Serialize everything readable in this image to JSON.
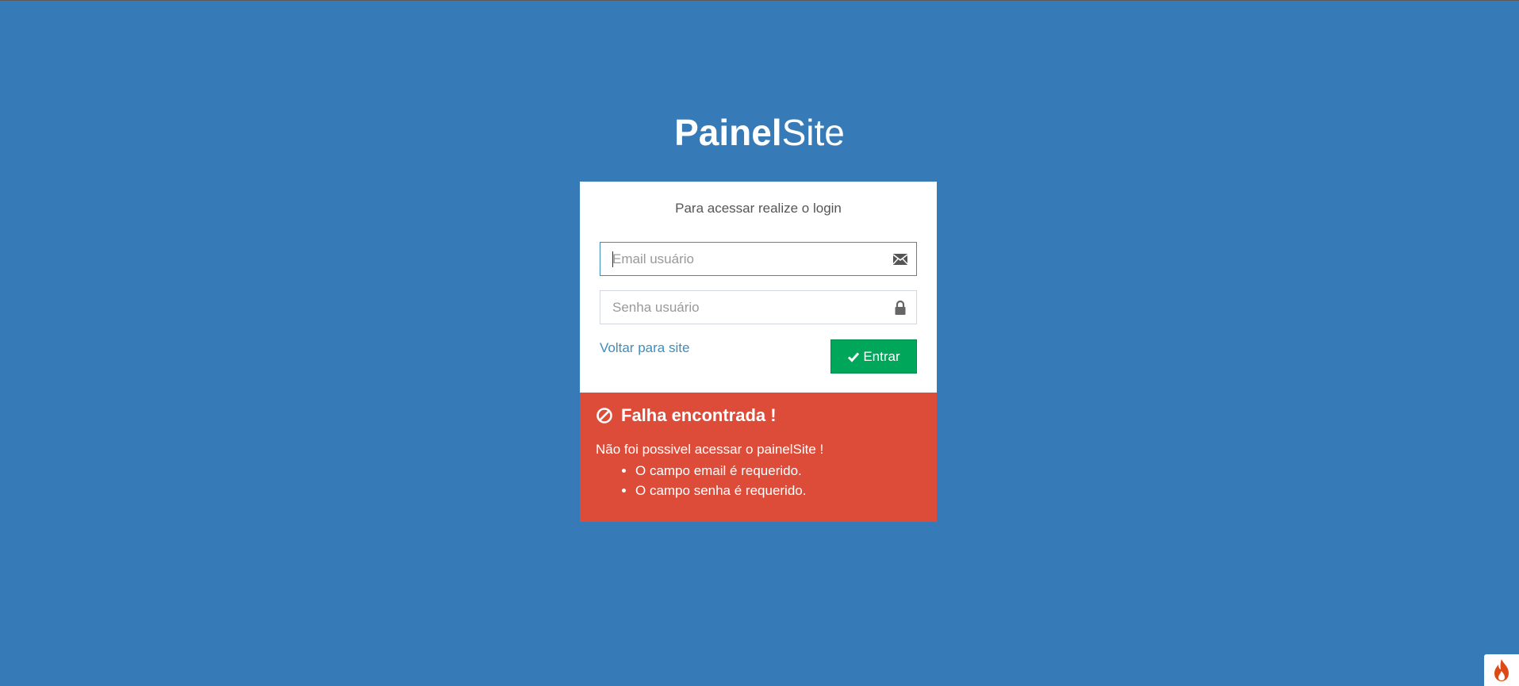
{
  "brand": {
    "bold": "Painel",
    "light": "Site"
  },
  "login": {
    "message": "Para acessar realize o login",
    "email_placeholder": "Email usuário",
    "email_icon": "envelope-icon",
    "password_placeholder": "Senha usuário",
    "password_icon": "lock-icon",
    "back_link": "Voltar para site",
    "submit_label": "Entrar",
    "submit_icon": "check-icon"
  },
  "alert": {
    "icon": "ban-icon",
    "title": "Falha encontrada !",
    "text": "Não foi possivel acessar o painelSite !",
    "errors": [
      "O campo email é requerido.",
      "O campo senha é requerido."
    ]
  },
  "debug_badge": {
    "icon": "flame-icon"
  },
  "colors": {
    "background": "#367ab8",
    "accent_link": "#3c8dbc",
    "button_success": "#00a65a",
    "alert_danger": "#dd4b39"
  }
}
